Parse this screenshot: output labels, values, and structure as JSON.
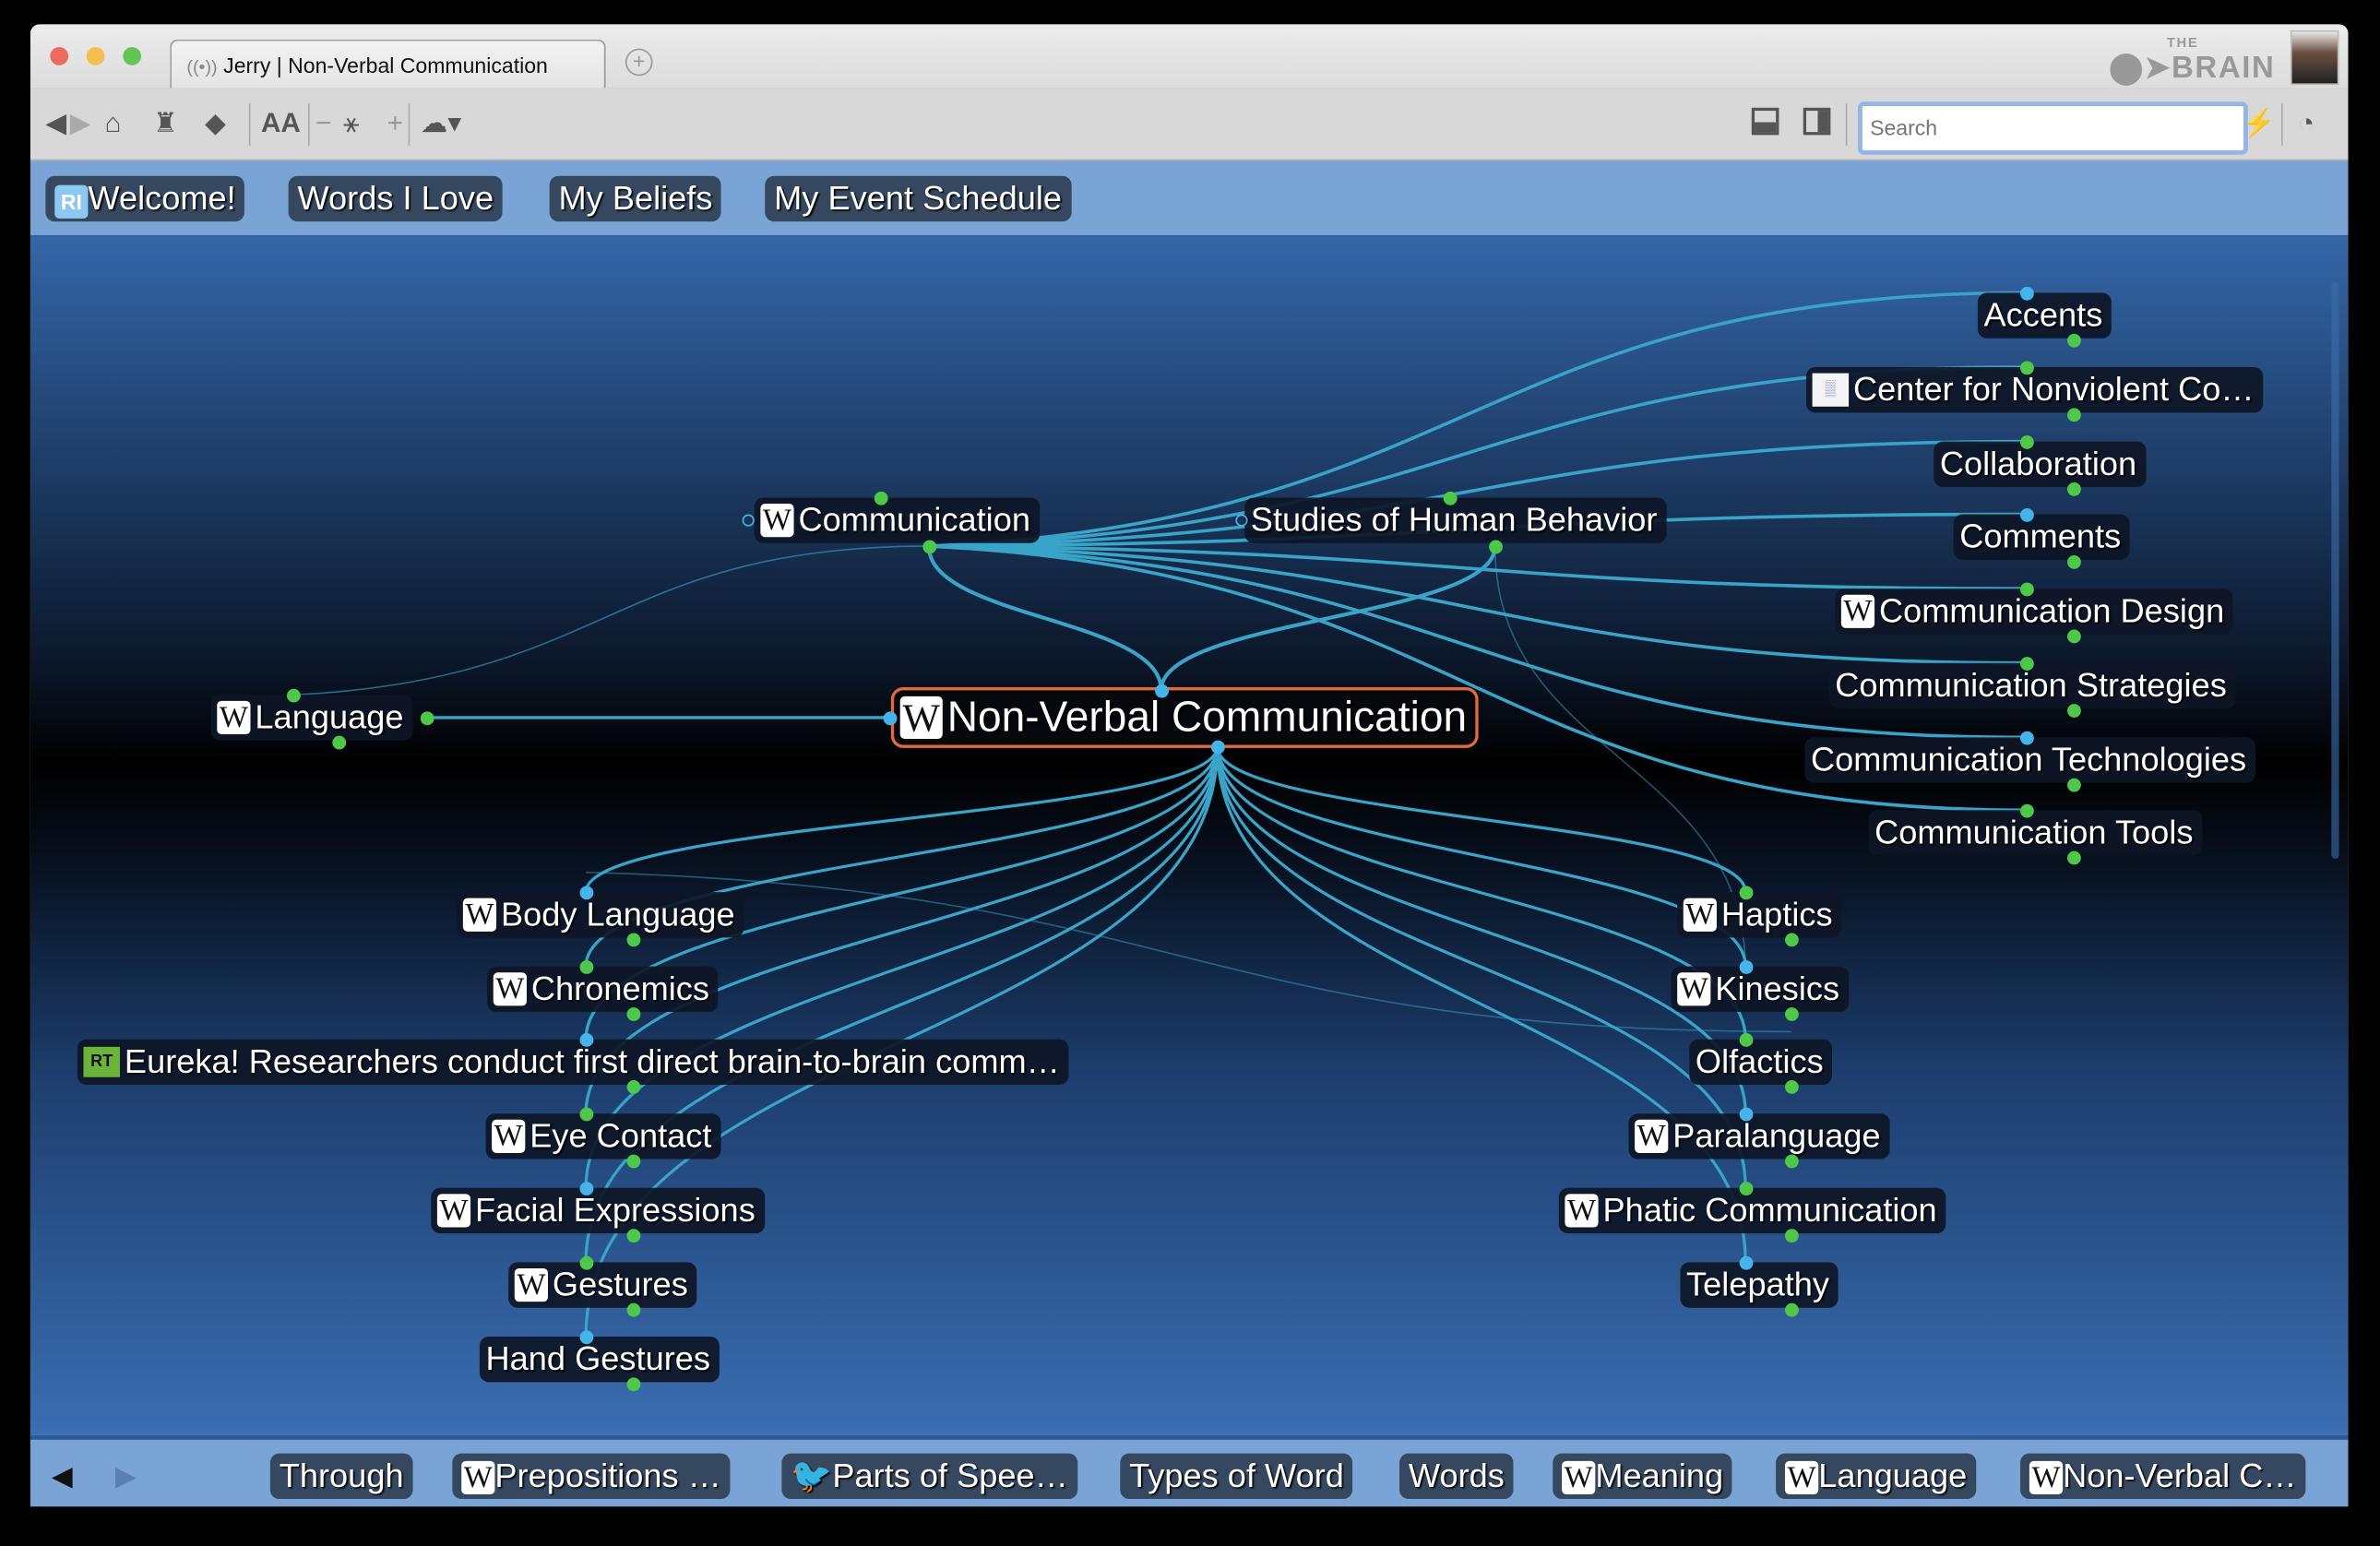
{
  "window": {
    "tab_title": "Jerry | Non-Verbal Communication",
    "logo_text": "THE BRAIN"
  },
  "toolbar": {
    "font_size_label": "AA",
    "search_placeholder": "Search"
  },
  "pins": [
    {
      "label": "Welcome!",
      "icon": "rt-logo-icon"
    },
    {
      "label": "Words I Love"
    },
    {
      "label": "My Beliefs"
    },
    {
      "label": "My Event Schedule"
    }
  ],
  "active_thought": {
    "label": "Non-Verbal Communication",
    "icon": "wikipedia-icon"
  },
  "parents": [
    {
      "label": "Communication",
      "icon": "wikipedia-icon"
    },
    {
      "label": "Studies of Human Behavior"
    }
  ],
  "jumps": [
    {
      "label": "Language",
      "icon": "wikipedia-icon"
    }
  ],
  "parent_siblings": [
    {
      "label": "Accents"
    },
    {
      "label": "Center for Nonviolent Co…",
      "icon": "image-icon"
    },
    {
      "label": "Collaboration"
    },
    {
      "label": "Comments"
    },
    {
      "label": "Communication Design",
      "icon": "wikipedia-icon"
    },
    {
      "label": "Communication Strategies"
    },
    {
      "label": "Communication Technologies"
    },
    {
      "label": "Communication Tools"
    }
  ],
  "children_left": [
    {
      "label": "Body Language",
      "icon": "wikipedia-icon"
    },
    {
      "label": "Chronemics",
      "icon": "wikipedia-icon"
    },
    {
      "label": "Eureka! Researchers conduct first direct brain-to-brain comm…",
      "icon": "rt-icon",
      "icon_text": "RT"
    },
    {
      "label": "Eye Contact",
      "icon": "wikipedia-icon"
    },
    {
      "label": "Facial Expressions",
      "icon": "wikipedia-icon"
    },
    {
      "label": "Gestures",
      "icon": "wikipedia-icon"
    },
    {
      "label": "Hand Gestures"
    }
  ],
  "children_right": [
    {
      "label": "Haptics",
      "icon": "wikipedia-icon"
    },
    {
      "label": "Kinesics",
      "icon": "wikipedia-icon"
    },
    {
      "label": "Olfactics"
    },
    {
      "label": "Paralanguage",
      "icon": "wikipedia-icon"
    },
    {
      "label": "Phatic Communication",
      "icon": "wikipedia-icon"
    },
    {
      "label": "Telepathy"
    }
  ],
  "history": [
    {
      "label": "Through"
    },
    {
      "label": "Prepositions …",
      "icon": "wikipedia-icon"
    },
    {
      "label": "Parts of Spee…",
      "icon": "bird-icon"
    },
    {
      "label": "Types of Word"
    },
    {
      "label": "Words"
    },
    {
      "label": "Meaning",
      "icon": "wikipedia-icon"
    },
    {
      "label": "Language",
      "icon": "wikipedia-icon"
    },
    {
      "label": "Non-Verbal C…",
      "icon": "wikipedia-icon"
    }
  ],
  "colors": {
    "link": "#3aa3c8",
    "active_border": "#e36a3a",
    "child_dot": "#4fc84a",
    "parent_dot": "#46b4ea"
  }
}
